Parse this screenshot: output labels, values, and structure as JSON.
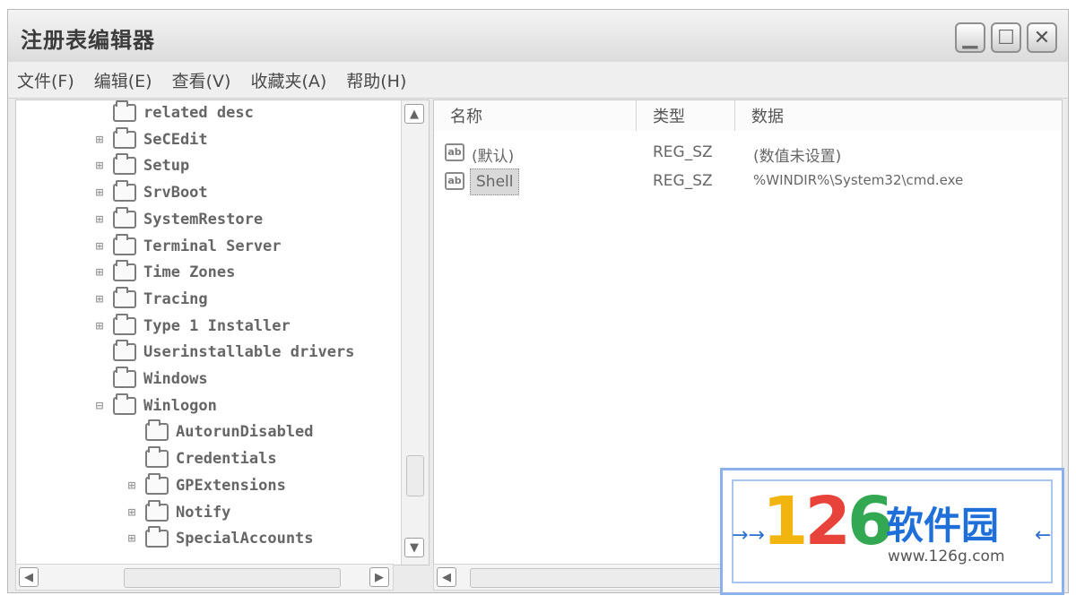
{
  "window": {
    "title": "注册表编辑器",
    "min_glyph": "▁",
    "max_glyph": "☐",
    "close_glyph": "✕"
  },
  "menu": [
    "文件(F)",
    "编辑(E)",
    "查看(V)",
    "收藏夹(A)",
    "帮助(H)"
  ],
  "tree": [
    {
      "label": "related desc",
      "indent": 0,
      "expander": ""
    },
    {
      "label": "SeCEdit",
      "indent": 0,
      "expander": "⊞"
    },
    {
      "label": "Setup",
      "indent": 0,
      "expander": "⊞"
    },
    {
      "label": "SrvBoot",
      "indent": 0,
      "expander": "⊞"
    },
    {
      "label": "SystemRestore",
      "indent": 0,
      "expander": "⊞"
    },
    {
      "label": "Terminal Server",
      "indent": 0,
      "expander": "⊞"
    },
    {
      "label": "Time Zones",
      "indent": 0,
      "expander": "⊞"
    },
    {
      "label": "Tracing",
      "indent": 0,
      "expander": "⊞"
    },
    {
      "label": "Type 1 Installer",
      "indent": 0,
      "expander": "⊞"
    },
    {
      "label": "Userinstallable drivers",
      "indent": 0,
      "expander": ""
    },
    {
      "label": "Windows",
      "indent": 0,
      "expander": ""
    },
    {
      "label": "Winlogon",
      "indent": 0,
      "expander": "⊟"
    },
    {
      "label": "AutorunDisabled",
      "indent": 1,
      "expander": ""
    },
    {
      "label": "Credentials",
      "indent": 1,
      "expander": ""
    },
    {
      "label": "GPExtensions",
      "indent": 1,
      "expander": "⊞"
    },
    {
      "label": "Notify",
      "indent": 1,
      "expander": "⊞"
    },
    {
      "label": "SpecialAccounts",
      "indent": 1,
      "expander": "⊞"
    }
  ],
  "columns": {
    "name": "名称",
    "type": "类型",
    "data": "数据"
  },
  "values": [
    {
      "icon": "ab",
      "name": "(默认)",
      "type": "REG_SZ",
      "data": "(数值未设置)"
    },
    {
      "icon": "ab",
      "name": "Shell",
      "type": "REG_SZ",
      "data": "%WINDIR%\\System32\\cmd.exe"
    }
  ],
  "scroll_glyphs": {
    "up": "▲",
    "down": "▼",
    "left": "◀",
    "right": "▶"
  },
  "watermark": {
    "digits": [
      "1",
      "2",
      "6"
    ],
    "text": "软件园",
    "url": "www.126g.com",
    "arrow_left": "→→",
    "arrow_right": "←"
  }
}
